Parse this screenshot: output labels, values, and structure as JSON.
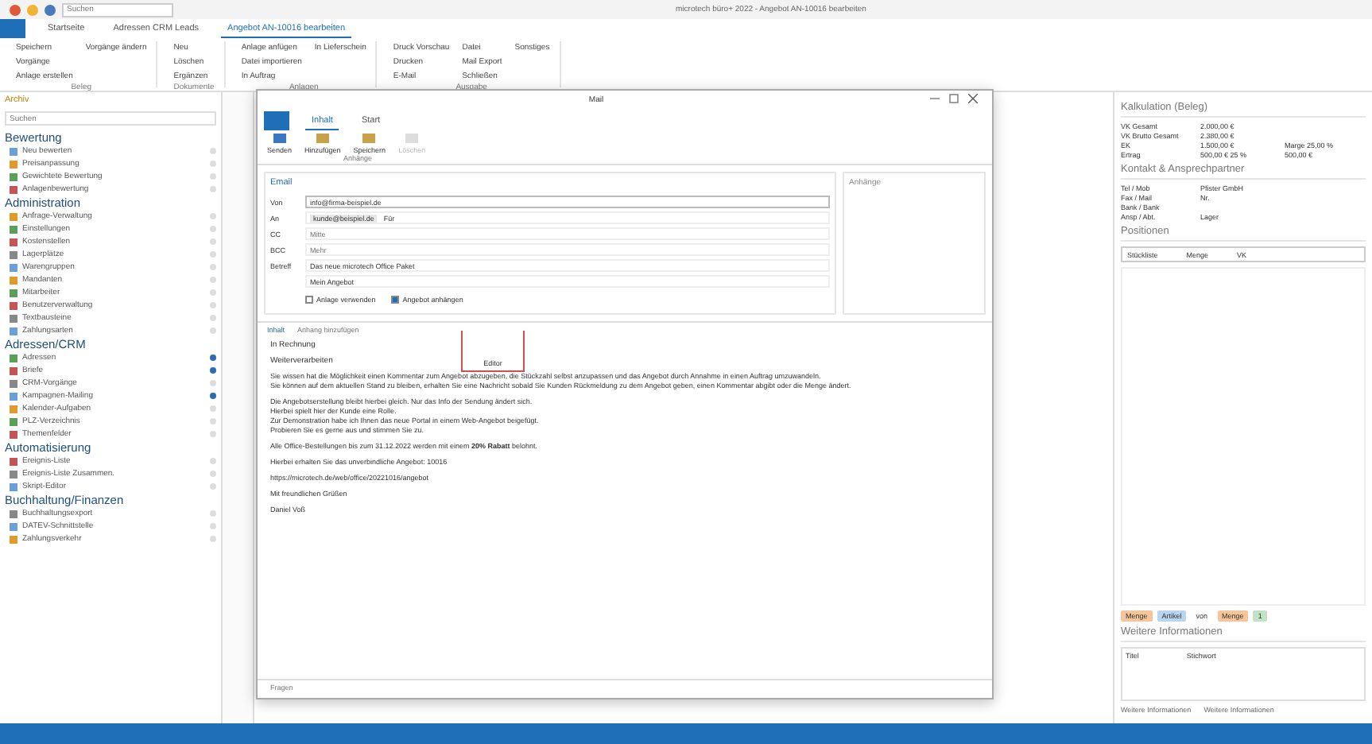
{
  "titlebar": {
    "search_placeholder": "Suchen",
    "title": "microtech büro+ 2022 - Angebot AN-10016 bearbeiten"
  },
  "ribbon_tabs": [
    {
      "label": "Startseite",
      "selected": false
    },
    {
      "label": "Adressen CRM Leads",
      "selected": false
    },
    {
      "label": "Angebot AN-10016 bearbeiten",
      "selected": true
    }
  ],
  "ribbon_groups": [
    {
      "label": "Beleg",
      "buttons": [
        "Speichern",
        "Vorgänge",
        "Anlage erstellen",
        "Vorgänge ändern"
      ]
    },
    {
      "label": "Dokumente",
      "buttons": [
        "Neu",
        "Löschen",
        "Ergänzen"
      ]
    },
    {
      "label": "Anlagen",
      "buttons": [
        "Anlage anfügen",
        "Datei importieren",
        "In Auftrag",
        "In Lieferschein"
      ]
    },
    {
      "label": "Ausgabe",
      "buttons": [
        "Druck Vorschau",
        "Drucken",
        "E-Mail",
        "Datei",
        "Mail Export",
        "Schließen",
        "Sonstiges"
      ]
    }
  ],
  "sidebar": {
    "header": "Archiv",
    "search_placeholder": "Suchen",
    "sections": [
      {
        "title": "Bewertung",
        "items": [
          {
            "label": "Neu bewerten",
            "pinned": false
          },
          {
            "label": "Preisanpassung",
            "pinned": false
          },
          {
            "label": "Gewichtete Bewertung",
            "pinned": false
          },
          {
            "label": "Anlagenbewertung",
            "pinned": false
          }
        ]
      },
      {
        "title": "Administration",
        "items": [
          {
            "label": "Anfrage-Verwaltung",
            "pinned": false
          },
          {
            "label": "Einstellungen",
            "pinned": false
          },
          {
            "label": "Kostenstellen",
            "pinned": false
          },
          {
            "label": "Lagerplätze",
            "pinned": false
          },
          {
            "label": "Warengruppen",
            "pinned": false
          },
          {
            "label": "Mandanten",
            "pinned": false
          },
          {
            "label": "Mitarbeiter",
            "pinned": false
          },
          {
            "label": "Benutzerverwaltung",
            "pinned": false
          },
          {
            "label": "Textbausteine",
            "pinned": false
          },
          {
            "label": "Zahlungsarten",
            "pinned": false
          }
        ]
      },
      {
        "title": "Adressen/CRM",
        "items": [
          {
            "label": "Adressen",
            "pinned": true
          },
          {
            "label": "Briefe",
            "pinned": true
          },
          {
            "label": "CRM-Vorgänge",
            "pinned": false
          },
          {
            "label": "Kampagnen-Mailing",
            "pinned": true
          },
          {
            "label": "Kalender-Aufgaben",
            "pinned": false
          },
          {
            "label": "PLZ-Verzeichnis",
            "pinned": false
          },
          {
            "label": "Themenfelder",
            "pinned": false
          }
        ]
      },
      {
        "title": "Automatisierung",
        "items": [
          {
            "label": "Ereignis-Liste",
            "pinned": false
          },
          {
            "label": "Ereignis-Liste Zusammen.",
            "pinned": false
          },
          {
            "label": "Skript-Editor",
            "pinned": false
          }
        ]
      },
      {
        "title": "Buchhaltung/Finanzen",
        "items": [
          {
            "label": "Buchhaltungsexport",
            "pinned": false
          },
          {
            "label": "DATEV-Schnittstelle",
            "pinned": false
          },
          {
            "label": "Zahlungsverkehr",
            "pinned": false
          }
        ]
      }
    ]
  },
  "mail": {
    "title": "Mail",
    "tabs": [
      {
        "label": "Inhalt",
        "selected": true
      },
      {
        "label": "Start",
        "selected": false
      }
    ],
    "buttons": [
      {
        "label": "Senden",
        "disabled": false
      },
      {
        "label": "Hinzufügen",
        "disabled": false
      },
      {
        "label": "Speichern",
        "disabled": false
      },
      {
        "label": "Löschen",
        "disabled": true
      }
    ],
    "group": "Anhänge",
    "section": "Email",
    "attachments_title": "Anhänge",
    "fields": [
      {
        "label": "Von",
        "value": "info@firma-beispiel.de",
        "kind": "select"
      },
      {
        "label": "An",
        "value": "kunde@beispiel.de",
        "extra": "Für",
        "kind": "chip"
      },
      {
        "label": "CC",
        "placeholder": "Mitte",
        "kind": "text"
      },
      {
        "label": "BCC",
        "placeholder": "Mehr",
        "kind": "text"
      },
      {
        "label": "Betreff",
        "value": "Das neue microtech Office Paket",
        "kind": "text"
      }
    ],
    "template": "Mein Angebot",
    "checks": [
      {
        "label": "Anlage verwenden",
        "checked": false
      },
      {
        "label": "Angebot anhängen",
        "checked": true
      }
    ],
    "content_tabs": [
      {
        "label": "Inhalt",
        "selected": true
      },
      {
        "label": "Anhang hinzufügen",
        "selected": false
      }
    ],
    "actions": [
      "In Rechnung",
      "Weiterverarbeiten"
    ],
    "tooltip": "Editor",
    "body": [
      "Sie wissen hat die Möglichkeit einen Kommentar zum Angebot abzugeben, die Stückzahl selbst anzupassen und das Angebot durch Annahme in einen Auftrag umzuwandeln.",
      "Sie können auf dem aktuellen Stand zu bleiben, erhalten Sie eine Nachricht sobald Sie Kunden Rückmeldung zu dem Angebot geben, einen Kommentar abgibt oder die Menge ändert.",
      "Die Angebotserstellung bleibt hierbei gleich. Nur das Info der Sendung ändert sich.\nHierbei spielt hier der Kunde eine Rolle.\nZur Demonstration habe ich Ihnen das neue Portal in einem Web-Angebot beigefügt.\nProbieren Sie es gerne aus und stimmen Sie zu.",
      "Alle Office-Bestellungen bis zum 31.12.2022 werden mit einem **20% Rabatt** belohnt.",
      "Hierbei erhalten Sie das unverbindliche Angebot: 10016",
      "https://microtech.de/web/office/20221016/angebot",
      "Mit freundlichen Grüßen",
      "Daniel Voß"
    ],
    "footer": "Fragen"
  },
  "right": {
    "calc_title": "Kalkulation (Beleg)",
    "calc_rows": [
      [
        "VK Gesamt",
        "2.000,00 €",
        ""
      ],
      [
        "VK Brutto Gesamt",
        "2.380,00 €",
        ""
      ],
      [
        "EK",
        "1.500,00 €",
        "Marge 25,00 %"
      ],
      [
        "Ertrag",
        "500,00 € 25 %",
        "500,00 €"
      ]
    ],
    "contact_title": "Kontakt & Ansprechpartner",
    "contact_rows": [
      [
        "Tel / Mob",
        "Pfister GmbH"
      ],
      [
        "Fax / Mail",
        "Nr."
      ],
      [
        "Bank / Bank",
        ""
      ],
      [
        "Ansp / Abt.",
        "Lager"
      ]
    ],
    "positions_title": "Positionen",
    "position_cols": [
      "Stückliste",
      "Menge",
      "VK"
    ],
    "tags": [
      {
        "label": "Menge",
        "color": "#f6c59a"
      },
      {
        "label": "Artikel",
        "color": "#b8d4ee"
      },
      {
        "label": "von",
        "color": "#ffffff"
      },
      {
        "label": "Menge",
        "color": "#f6c59a"
      },
      {
        "label": "1",
        "color": "#bfe3c4"
      }
    ],
    "info_title": "Weitere Informationen",
    "info_cols": [
      "Titel",
      "Stichwort"
    ],
    "footer": [
      "Weitere Informationen",
      "Weitere Informationen"
    ]
  }
}
